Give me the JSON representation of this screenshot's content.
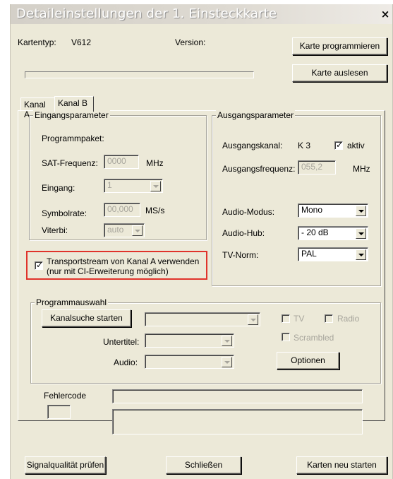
{
  "window": {
    "title": "Detaileinstellungen der 1. Einsteckkarte",
    "close_glyph": "×"
  },
  "card": {
    "type_label": "Kartentyp:",
    "type_value": "V612",
    "version_label": "Version:",
    "program_button": "Karte programmieren",
    "read_button": "Karte auslesen"
  },
  "tabs": [
    {
      "label": "Kanal A",
      "active": false
    },
    {
      "label": "Kanal B",
      "active": true
    }
  ],
  "input_params": {
    "title": "Eingangsparameter",
    "programmpaket_label": "Programmpaket:",
    "sat_label": "SAT-Frequenz:",
    "sat_value": "0000",
    "sat_unit": "MHz",
    "eingang_label": "Eingang:",
    "eingang_value": "1",
    "symbolrate_label": "Symbolrate:",
    "symbolrate_value": "00,000",
    "symbolrate_unit": "MS/s",
    "viterbi_label": "Viterbi:",
    "viterbi_value": "auto"
  },
  "transport": {
    "checked": true,
    "line1": "Transportstream von Kanal A verwenden",
    "line2": "(nur mit CI-Erweiterung möglich)"
  },
  "output_params": {
    "title": "Ausgangsparameter",
    "kanal_label": "Ausgangskanal:",
    "kanal_value": "K 3",
    "aktiv_label": "aktiv",
    "aktiv_checked": true,
    "freq_label": "Ausgangsfrequenz:",
    "freq_value": "055,2",
    "freq_unit": "MHz",
    "audio_modus_label": "Audio-Modus:",
    "audio_modus_value": "Mono",
    "audio_hub_label": "Audio-Hub:",
    "audio_hub_value": "- 20 dB",
    "tv_norm_label": "TV-Norm:",
    "tv_norm_value": "PAL"
  },
  "program_selection": {
    "title": "Programmauswahl",
    "search_button": "Kanalsuche starten",
    "tv_label": "TV",
    "radio_label": "Radio",
    "scrambled_label": "Scrambled",
    "untertitel_label": "Untertitel:",
    "audio_label": "Audio:",
    "options_button": "Optionen"
  },
  "error": {
    "label": "Fehlercode"
  },
  "footer": {
    "signal_button": "Signalqualität prüfen",
    "close_button": "Schließen",
    "restart_button": "Karten neu starten"
  },
  "colors": {
    "highlight": "#e0332b",
    "dialog_bg": "#ece9d8"
  }
}
